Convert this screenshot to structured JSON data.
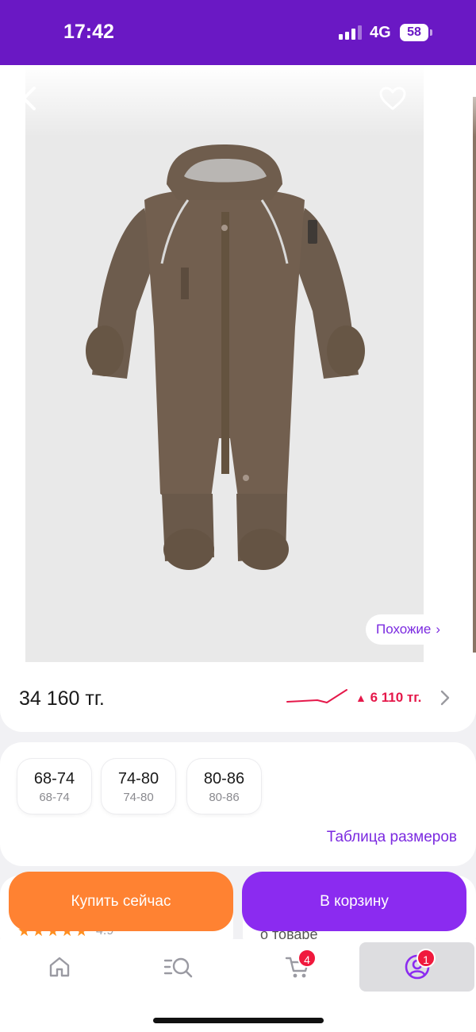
{
  "status_bar": {
    "time": "17:42",
    "network": "4G",
    "battery": "58"
  },
  "product": {
    "similar_label": "Похожие",
    "price": "34 160 тг.",
    "price_change": "6 110 тг."
  },
  "sizes": [
    {
      "main": "68-74",
      "sub": "68-74"
    },
    {
      "main": "74-80",
      "sub": "74-80"
    },
    {
      "main": "80-86",
      "sub": "80-86"
    }
  ],
  "size_table_label": "Таблица размеров",
  "reviews_peek": {
    "stars": "★★★★★",
    "rating": "4.9",
    "about_label": "о товаре"
  },
  "actions": {
    "buy_now": "Купить сейчас",
    "add_to_cart": "В корзину"
  },
  "tab_bar": {
    "cart_badge": "4",
    "profile_badge": "1"
  },
  "colors": {
    "brand": "#6a18c4",
    "accent": "#8b2bf0",
    "buy": "#ff8232",
    "price_up": "#e5184a"
  },
  "icons": [
    "back-icon",
    "heart-icon",
    "share-icon",
    "trend-line-icon",
    "chevron-right-icon",
    "home-icon",
    "catalog-search-icon",
    "cart-icon",
    "profile-icon"
  ]
}
